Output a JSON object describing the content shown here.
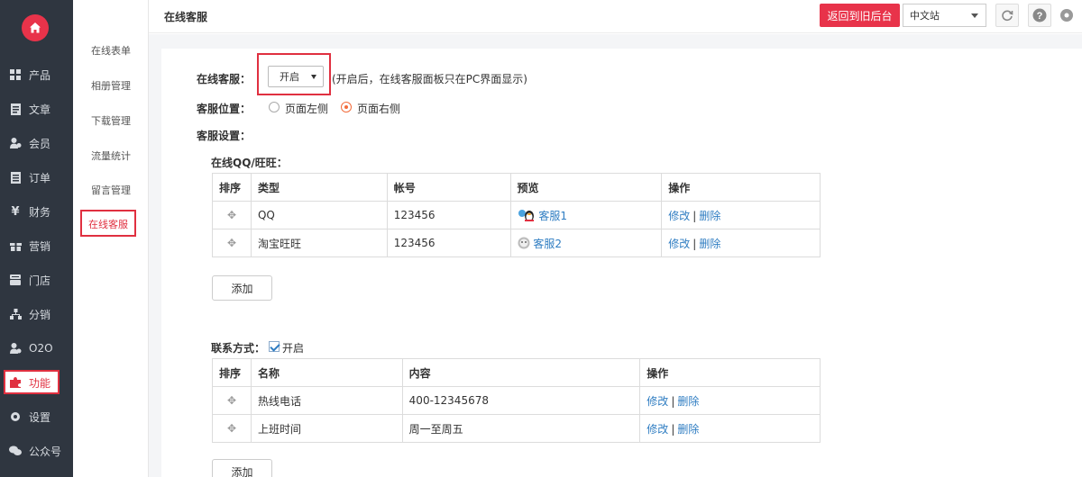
{
  "sidebar": {
    "items": [
      {
        "label": "产品",
        "icon": "grid-icon"
      },
      {
        "label": "文章",
        "icon": "document-icon"
      },
      {
        "label": "会员",
        "icon": "user-icon"
      },
      {
        "label": "订单",
        "icon": "order-icon"
      },
      {
        "label": "财务",
        "icon": "yen-icon"
      },
      {
        "label": "营销",
        "icon": "gift-icon"
      },
      {
        "label": "门店",
        "icon": "store-icon"
      },
      {
        "label": "分销",
        "icon": "network-icon"
      },
      {
        "label": "O2O",
        "icon": "o2o-icon"
      },
      {
        "label": "功能",
        "icon": "puzzle-icon"
      },
      {
        "label": "设置",
        "icon": "gear-icon"
      },
      {
        "label": "公众号",
        "icon": "wechat-icon"
      }
    ]
  },
  "submenu": {
    "items": [
      "在线表单",
      "相册管理",
      "下载管理",
      "流量统计",
      "留言管理",
      "在线客服"
    ]
  },
  "topbar": {
    "title": "在线客服",
    "back_label": "返回到旧后台",
    "lang": "中文站"
  },
  "form": {
    "service_label": "在线客服：",
    "service_value": "开启",
    "service_hint": "(开启后，在线客服面板只在PC界面显示)",
    "position_label": "客服位置：",
    "position_left": "页面左侧",
    "position_right": "页面右侧",
    "settings_label": "客服设置："
  },
  "qq_section": {
    "title": "在线QQ/旺旺：",
    "headers": [
      "排序",
      "类型",
      "帐号",
      "预览",
      "操作"
    ],
    "rows": [
      {
        "type": "QQ",
        "account": "123456",
        "preview": "客服1"
      },
      {
        "type": "淘宝旺旺",
        "account": "123456",
        "preview": "客服2"
      }
    ],
    "edit": "修改",
    "delete": "删除",
    "add_label": "添加"
  },
  "contact_section": {
    "title": "联系方式：",
    "enabled_label": "开启",
    "headers": [
      "排序",
      "名称",
      "内容",
      "操作"
    ],
    "rows": [
      {
        "name": "热线电话",
        "content": "400-12345678"
      },
      {
        "name": "上班时间",
        "content": "周一至周五"
      }
    ],
    "edit": "修改",
    "delete": "删除",
    "add_label": "添加"
  },
  "colors": {
    "accent": "#e8334a",
    "sidebar_bg": "#2f3640",
    "link": "#2f7dc2"
  }
}
